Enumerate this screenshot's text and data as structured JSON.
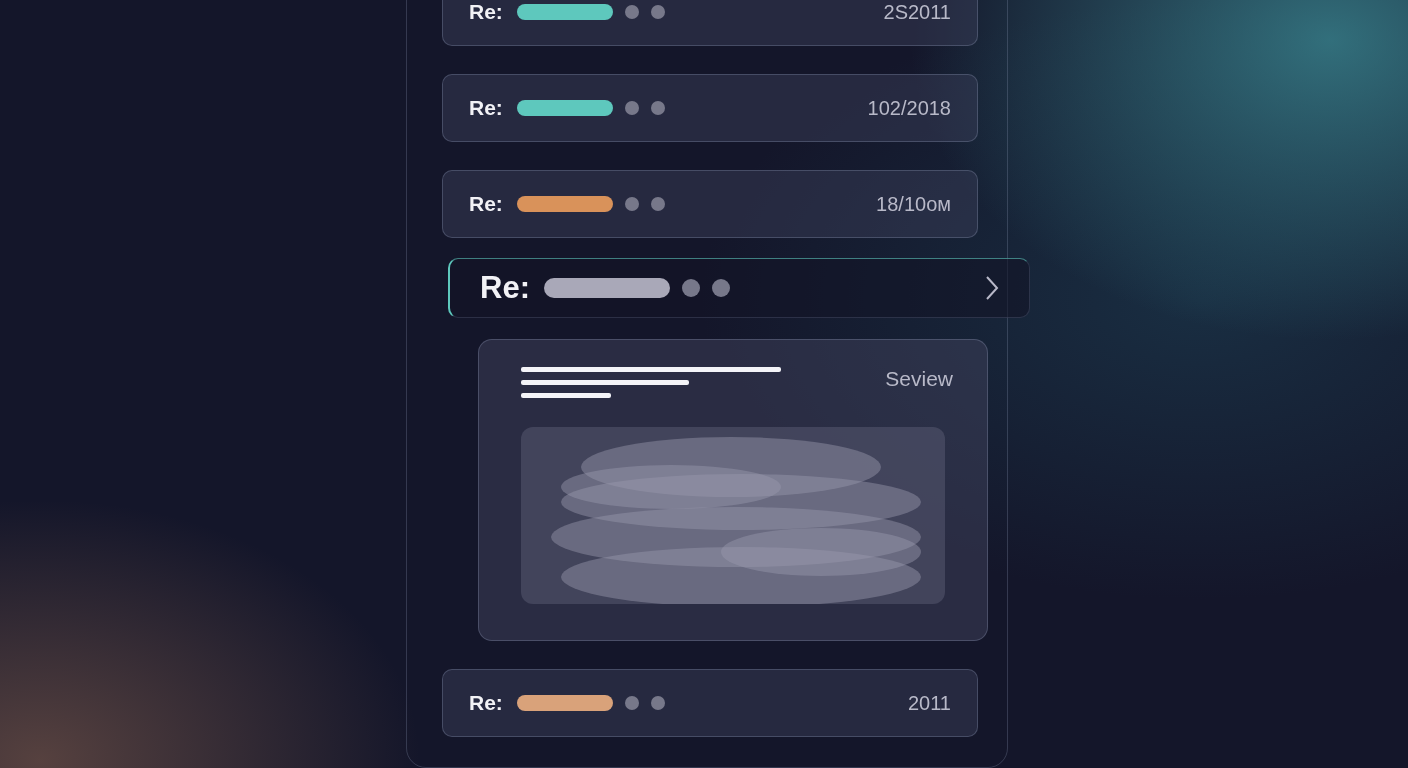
{
  "messages": [
    {
      "prefix": "Re:",
      "color": "#5ec8bd",
      "date": "2S2011",
      "selected": false
    },
    {
      "prefix": "Re:",
      "color": "#5ec8bd",
      "date": "102/2018",
      "selected": false
    },
    {
      "prefix": "Re:",
      "color": "#d9925a",
      "date": "18/10oм",
      "selected": false
    },
    {
      "prefix": "Re:",
      "color": "#a9a8b8",
      "selected": true
    }
  ],
  "preview": {
    "label": "Seview"
  },
  "more_messages": [
    {
      "prefix": "Re:",
      "color": "#d9a27a",
      "date": "2011",
      "selected": false
    }
  ]
}
